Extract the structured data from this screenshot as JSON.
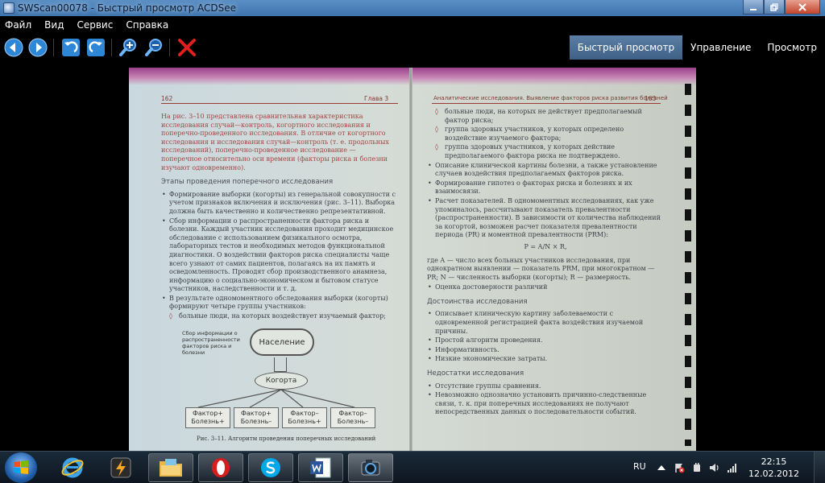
{
  "window": {
    "title": "SWScan00078 - Быстрый просмотр ACDSee"
  },
  "menu": [
    "Файл",
    "Вид",
    "Сервис",
    "Справка"
  ],
  "modes": [
    {
      "label": "Быстрый просмотр",
      "active": true
    },
    {
      "label": "Управление",
      "active": false
    },
    {
      "label": "Просмотр",
      "active": false
    }
  ],
  "scan": {
    "left_page_number": "162",
    "left_chapter": "Глава 3",
    "right_header": "Аналитические исследования. Выявление факторов риска развития болезней",
    "right_page_number": "163",
    "left_intro": "На рис. 3–10 представлена сравнительная характеристика исследования случай—контроль, когортного исследования и поперечно-проведенного исследования. В отличие от когортного исследования и исследования случай—контроль (т. е. продольных исследований), поперечно-проведенное исследование — поперечное относительно оси времени (факторы риска и болезни изучают одновременно).",
    "left_heading": "Этапы проведения поперечного исследования",
    "left_items": [
      "Формирование выборки (когорты) из генеральной совокупности с учетом признаков включения и исключения (рис. 3–11). Выборка должна быть качественно и количественно репрезентативной.",
      "Сбор информации о распространенности фактора риска и болезни. Каждый участник исследования проходит медицинское обследование с использованием физикального осмотра, лабораторных тестов и необходимых методов функциональной диагностики. О воздействии факторов риска специалисты чаще всего узнают от самих пациентов, полагаясь на их память и осведомленность. Проводят сбор производственного анамнеза, информацию о социально-экономическом и бытовом статусе участников, наследственности и т. д.",
      "В результате одномоментного обследования выборки (когорты) формируют четыре группы участников:"
    ],
    "left_sub": "больные люди, на которых воздействует изучаемый фактор;",
    "diagram": {
      "side_note": "Сбор информации о распространенности факторов риска и болезни",
      "population": "Население",
      "cohort": "Когорта",
      "factors": [
        "Фактор+ Болезнь+",
        "Фактор+ Болезнь–",
        "Фактор– Болезнь+",
        "Фактор– Болезнь–"
      ],
      "caption": "Рис. 3–11. Алгоритм проведения поперечных исследований"
    },
    "right_subs": [
      "больные люди, на которых не действует предполагаемый фактор риска;",
      "группа здоровых участников, у которых определено воздействие изучаемого фактора;",
      "группа здоровых участников, у которых действие предполагаемого фактора риска не подтверждено."
    ],
    "right_items": [
      "Описание клинической картины болезни, а также установление случаев воздействия предполагаемых факторов риска.",
      "Формирование гипотез о факторах риска и болезнях и их взаимосвязи.",
      "Расчет показателей. В одномоментных исследованиях, как уже упоминалось, рассчитывают показатель превалентности (распространенности). В зависимости от количества наблюдений за когортой, возможен расчет показателя превалентности периода (PR) и моментной превалентности (PRM):"
    ],
    "formula": "P = A/N × R,",
    "formula_where": "где A — число всех больных участников исследования, при однократном выявлении — показатель PRM, при многократном — PR; N — численность выборки (когорты); R — размерность.",
    "right_item_last": "Оценка достоверности различий",
    "adv_heading": "Достоинства исследования",
    "adv_items": [
      "Описывает клиническую картину заболеваемости с одновременной регистрацией факта воздействия изучаемой причины.",
      "Простой алгоритм проведения.",
      "Информативность.",
      "Низкие экономические затраты."
    ],
    "dis_heading": "Недостатки исследования",
    "dis_items": [
      "Отсутствие группы сравнения.",
      "Невозможно однозначно установить причинно-следственные связи, т. к. при поперечных исследованиях не получают непосредственных данных о последовательности событий."
    ]
  },
  "taskbar": {
    "apps": [
      "windows-explorer",
      "internet-explorer",
      "winamp",
      "file-explorer",
      "opera",
      "skype",
      "word",
      "acdsee"
    ],
    "language": "RU",
    "time": "22:15",
    "date": "12.02.2012"
  },
  "colors": {
    "accent": "#3f6088",
    "titlebar": "#4a7fb8",
    "close": "#c2442c"
  }
}
